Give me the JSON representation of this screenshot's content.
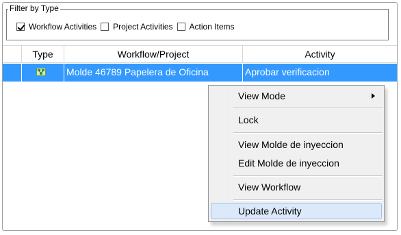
{
  "filter": {
    "legend": "Filter by Type",
    "options": [
      {
        "label": "Workflow Activities",
        "checked": true
      },
      {
        "label": "Project Activities",
        "checked": false
      },
      {
        "label": "Action Items",
        "checked": false
      }
    ]
  },
  "grid": {
    "columns": [
      "",
      "Type",
      "Workflow/Project",
      "Activity"
    ],
    "rows": [
      {
        "type_icon": "workflow-icon",
        "workflow_project": "Molde 46789 Papelera de Oficina",
        "activity": "Aprobar verificacion",
        "selected": true
      }
    ]
  },
  "context_menu": {
    "items": [
      {
        "label": "View Mode",
        "has_submenu": true
      },
      {
        "label": "Lock"
      },
      {
        "label": "View Molde de inyeccion"
      },
      {
        "label": "Edit Molde de inyeccion"
      },
      {
        "label": "View Workflow"
      },
      {
        "label": "Update Activity",
        "hovered": true
      }
    ]
  },
  "colors": {
    "selection": "#3399ff",
    "menu_background": "#f0f0f0",
    "menu_hover": "#dbe9fb"
  }
}
